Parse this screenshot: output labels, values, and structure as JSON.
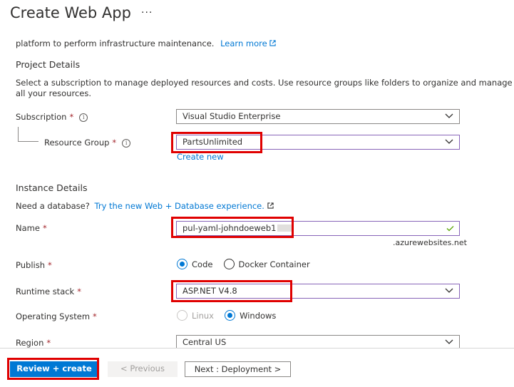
{
  "header": {
    "title": "Create Web App",
    "more_label": "···"
  },
  "intro": {
    "text": "platform to perform infrastructure maintenance.",
    "learn_more": "Learn more"
  },
  "project": {
    "heading": "Project Details",
    "description_line1": "Select a subscription to manage deployed resources and costs. Use resource groups like folders to organize and manage",
    "description_line2": "all your resources.",
    "subscription_label": "Subscription",
    "subscription_value": "Visual Studio Enterprise",
    "resource_group_label": "Resource Group",
    "resource_group_value": "PartsUnlimited",
    "create_new": "Create new"
  },
  "instance": {
    "heading": "Instance Details",
    "database_prompt": "Need a database?",
    "database_link": "Try the new Web + Database experience.",
    "name_label": "Name",
    "name_value": "pul-yaml-johndoeweb1",
    "name_suffix": ".azurewebsites.net",
    "publish_label": "Publish",
    "publish_options": [
      "Code",
      "Docker Container"
    ],
    "runtime_label": "Runtime stack",
    "runtime_value": "ASP.NET V4.8",
    "os_label": "Operating System",
    "os_options": [
      "Linux",
      "Windows"
    ],
    "region_label": "Region",
    "region_value": "Central US",
    "required_mark": "*",
    "info_glyph": "i"
  },
  "footer": {
    "review_create": "Review + create",
    "previous": "< Previous",
    "next": "Next : Deployment >"
  },
  "colors": {
    "accent": "#0078d4",
    "highlight": "#e00000",
    "required": "#a4262c"
  }
}
